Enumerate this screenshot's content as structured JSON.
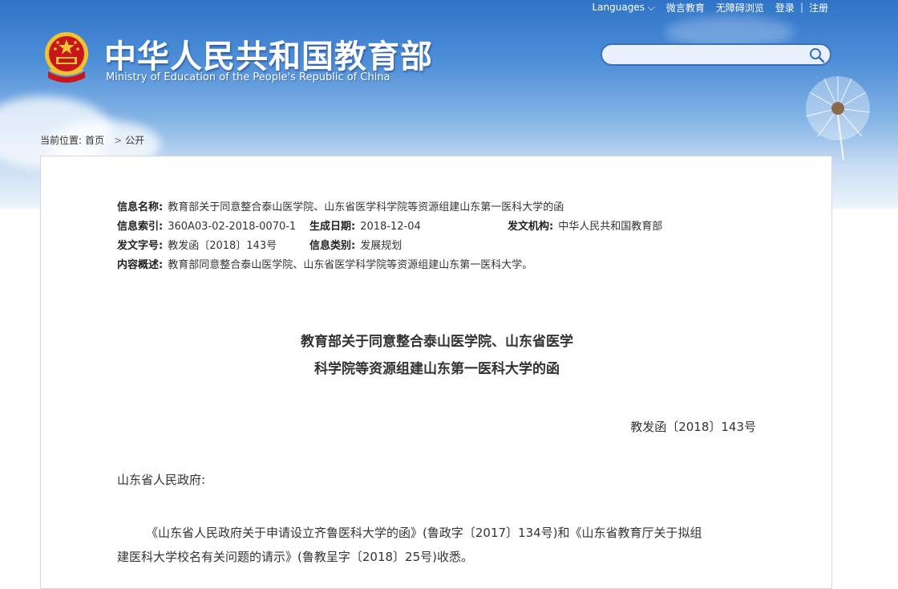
{
  "header": {
    "title": "中华人民共和国教育部",
    "subtitle": "Ministry of Education of the People's Republic of China",
    "links": {
      "languages": "Languages",
      "weibo": "微言教育",
      "accessible": "无障碍浏览",
      "login": "登录",
      "divider": "|",
      "register": "注册"
    },
    "search": {
      "placeholder": "",
      "value": ""
    }
  },
  "breadcrumb": {
    "prefix": "当前位置:",
    "home": "首页",
    "separator": ">",
    "current": "公开"
  },
  "info": {
    "name_label": "信息名称:",
    "name_value": "教育部关于同意整合泰山医学院、山东省医学科学院等资源组建山东第一医科大学的函",
    "index_label": "信息索引:",
    "index_value": "360A03-02-2018-0070-1",
    "date_label": "生成日期:",
    "date_value": "2018-12-04",
    "issuer_label": "发文机构:",
    "issuer_value": "中华人民共和国教育部",
    "docno_label": "发文字号:",
    "docno_value": "教发函〔2018〕143号",
    "category_label": "信息类别:",
    "category_value": "发展规划",
    "summary_label": "内容概述:",
    "summary_value": "教育部同意整合泰山医学院、山东省医学科学院等资源组建山东第一医科大学。"
  },
  "document": {
    "title_line1": "教育部关于同意整合泰山医学院、山东省医学",
    "title_line2": "科学院等资源组建山东第一医科大学的函",
    "number": "教发函〔2018〕143号",
    "salutation": "山东省人民政府:",
    "para1_line1": "《山东省人民政府关于申请设立齐鲁医科大学的函》(鲁政字〔2017〕134号)和《山东省教育厅关于拟组",
    "para1_line2": "建医科大学校名有关问题的请示》(鲁教呈字〔2018〕25号)收悉。"
  },
  "colors": {
    "banner_top": "#2f74c8",
    "banner_bottom": "#eef5fc",
    "text": "#333333",
    "panel_border": "#d8d8d8",
    "emblem_red": "#c8161d",
    "emblem_gold": "#f1c232"
  }
}
